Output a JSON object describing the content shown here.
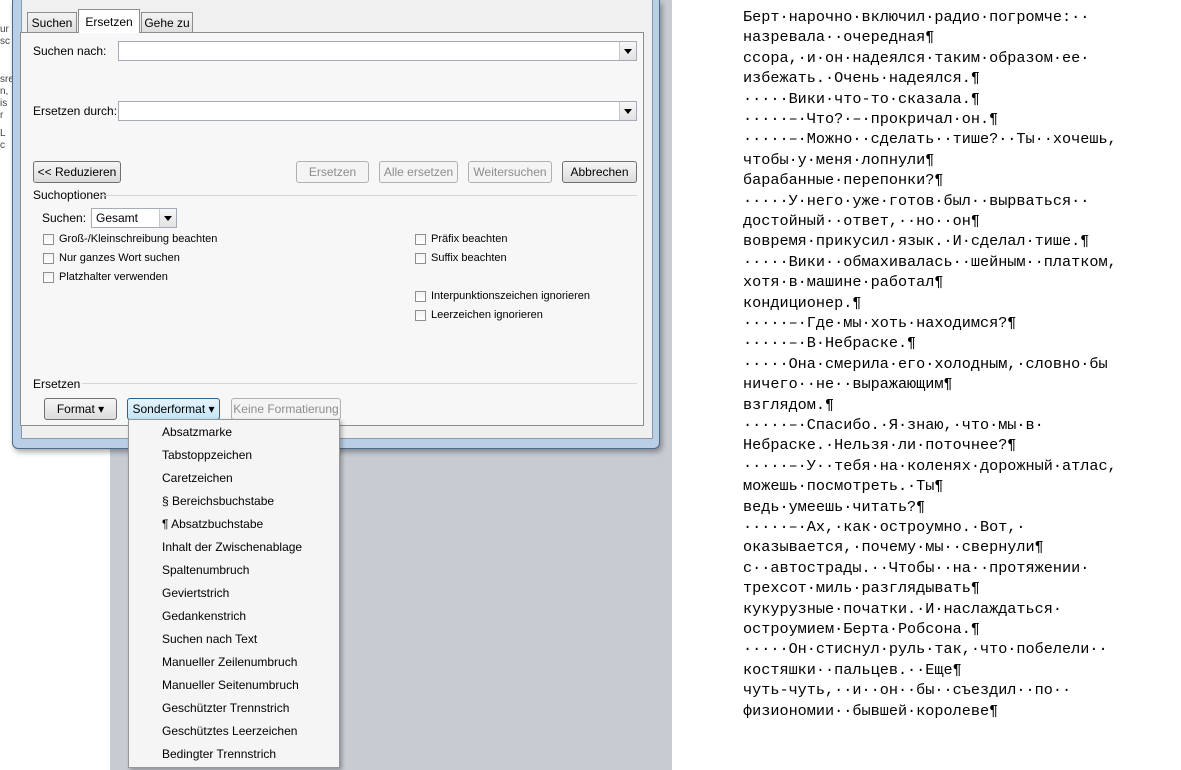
{
  "dialog": {
    "tabs": [
      "Suchen",
      "Ersetzen",
      "Gehe zu"
    ],
    "active_tab": "Ersetzen",
    "search_label": "Suchen nach:",
    "search_value": "",
    "replace_label": "Ersetzen durch:",
    "replace_value": "",
    "buttons": {
      "reduce": "<< Reduzieren",
      "replace": "Ersetzen",
      "replace_all": "Alle ersetzen",
      "find_next": "Weitersuchen",
      "cancel": "Abbrechen"
    },
    "options_title": "Suchoptionen",
    "search_dir_label": "Suchen:",
    "search_dir_value": "Gesamt",
    "checkboxes_left": [
      "Groß-/Kleinschreibung beachten",
      "Nur ganzes Wort suchen",
      "Platzhalter verwenden"
    ],
    "checkboxes_right": [
      "Präfix beachten",
      "Suffix beachten",
      "Interpunktionszeichen ignorieren",
      "Leerzeichen ignorieren"
    ],
    "replace_section_title": "Ersetzen",
    "format_button": "Format ▾",
    "special_button": "Sonderformat ▾",
    "no_format_button": "Keine Formatierung"
  },
  "special_menu": {
    "items": [
      "Absatzmarke",
      "Tabstoppzeichen",
      "Caretzeichen",
      "§ Bereichsbuchstabe",
      "¶ Absatzbuchstabe",
      "Inhalt der Zwischenablage",
      "Spaltenumbruch",
      "Geviertstrich",
      "Gedankenstrich",
      "Suchen nach Text",
      "Manueller Zeilenumbruch",
      "Manueller Seitenumbruch",
      "Geschützter Trennstrich",
      "Geschütztes Leerzeichen",
      "Bedingter Trennstrich"
    ]
  },
  "left_edge_fragments": [
    "ur",
    "sc",
    "sre",
    "n,",
    "is",
    "r",
    "L",
    "c"
  ],
  "document": {
    "lines": [
      "Берт·нарочно·включил·радио·погромче:··",
      "назревала··очередная¶",
      "ссора,·и·он·надеялся·таким·образом·ее·",
      "избежать.·Очень·надеялся.¶",
      "·····Вики·что-то·сказала.¶",
      "·····–·Что?·–·прокричал·он.¶",
      "·····–·Можно··сделать··тише?··Ты··хочешь,",
      "чтобы·у·меня·лопнули¶",
      "барабанные·перепонки?¶",
      "·····У·него·уже·готов·был··вырваться··",
      "достойный··ответ,··но··он¶",
      "вовремя·прикусил·язык.·И·сделал·тише.¶",
      "·····Вики··обмахивалась··шейным··платком,",
      "хотя·в·машине·работал¶",
      "кондиционер.¶",
      "·····–·Где·мы·хоть·находимся?¶",
      "·····–·В·Небраске.¶",
      "·····Она·смерила·его·холодным,·словно·бы",
      "ничего··не··выражающим¶",
      "взглядом.¶",
      "·····–·Спасибо.·Я·знаю,·что·мы·в·",
      "Небраске.·Нельзя·ли·поточнее?¶",
      "·····–·У··тебя·на·коленях·дорожный·атлас,",
      "можешь·посмотреть.·Ты¶",
      "ведь·умеешь·читать?¶",
      "·····–·Ах,·как·остроумно.·Вот,·",
      "оказывается,·почему·мы··свернули¶",
      "с··автострады.··Чтобы··на··протяжении·",
      "трехсот·миль·разглядывать¶",
      "кукурузные·початки.·И·наслаждаться·",
      "остроумием·Берта·Робсона.¶",
      "·····Он·стиснул·руль·так,·что·побелели··",
      "костяшки··пальцев.··Еще¶",
      "чуть-чуть,··и··он··бы··съездил··по··",
      "физиономии··бывшей·королеве¶"
    ]
  }
}
